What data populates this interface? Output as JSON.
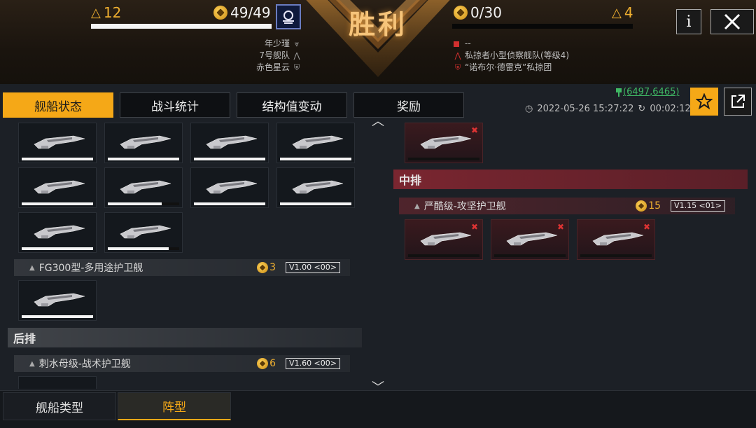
{
  "header": {
    "left_triangle_count": "12",
    "left_coin_count": "49/49",
    "title": "胜利",
    "right_coin_count": "0/30",
    "right_triangle_count": "4",
    "left_info": [
      {
        "text": "年少瑾"
      },
      {
        "text": "7号舰队"
      },
      {
        "text": "赤色星云"
      }
    ],
    "right_info": [
      {
        "text": "--"
      },
      {
        "text": "私掠者小型侦察舰队(等级4)"
      },
      {
        "text": "“诺布尔·德雷克”私掠团"
      }
    ],
    "info_button_label": "i"
  },
  "tabs": [
    {
      "label": "舰船状态",
      "active": true
    },
    {
      "label": "战斗统计",
      "active": false
    },
    {
      "label": "结构值变动",
      "active": false
    },
    {
      "label": "奖励",
      "active": false
    }
  ],
  "meta": {
    "coordinates": "(6497,6465)",
    "datetime": "2022-05-26 15:27:22",
    "duration": "00:02:12"
  },
  "left_pane": {
    "top_ships_hp": [
      1,
      1,
      1,
      1,
      1,
      0.75,
      1,
      1,
      1,
      0.85
    ],
    "groups": [
      {
        "name": "FG300型-多用途护卫舰",
        "count": "3",
        "version": "V1.00 <00>"
      }
    ],
    "fg300_ships_hp": [
      1
    ],
    "rear_section": "后排",
    "rear_groups": [
      {
        "name": "刺水母级-战术护卫舰",
        "count": "6",
        "version": "V1.60 <00>"
      }
    ]
  },
  "right_pane": {
    "top_enemy_ships_hp": [
      0
    ],
    "middle_section": "中排",
    "groups": [
      {
        "name": "严酷级-攻坚护卫舰",
        "count": "15",
        "version": "V1.15 <01>"
      }
    ],
    "enemy_ships_hp": [
      0,
      0,
      0
    ]
  },
  "bottom_tabs": [
    {
      "label": "舰船类型",
      "active": false
    },
    {
      "label": "阵型",
      "active": true
    }
  ],
  "colors": {
    "accent": "#f5a817",
    "enemy": "#7a2630",
    "coord_green": "#3fb864"
  }
}
